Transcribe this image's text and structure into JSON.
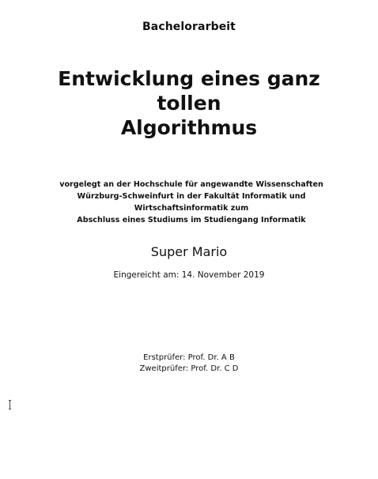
{
  "document": {
    "type": "Bachelorarbeit",
    "title_lines": [
      "Entwicklung eines ganz",
      "tollen",
      "Algorithmus"
    ],
    "institution_lines": [
      "vorgelegt an der Hochschule für angewandte Wissenschaften",
      "Würzburg-Schweinfurt in der Fakultät Informatik und",
      "Wirtschaftsinformatik zum",
      "Abschluss eines Studiums im Studiengang Informatik"
    ],
    "author": "Super Mario",
    "submitted": "Eingereicht am: 14. November 2019",
    "first_examiner": "Erstprüfer: Prof. Dr. A B",
    "second_examiner": "Zweitprüfer: Prof. Dr. C D"
  }
}
